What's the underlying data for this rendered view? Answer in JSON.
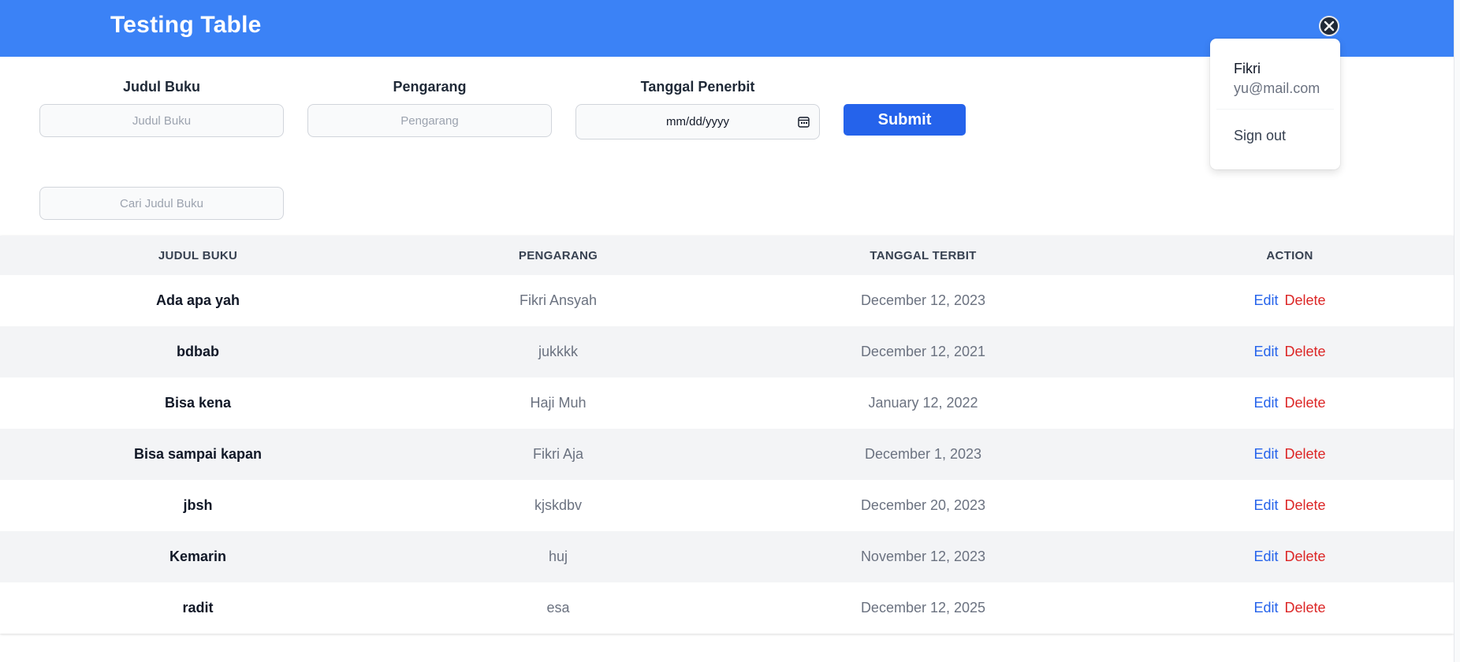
{
  "header": {
    "title": "Testing Table",
    "avatar_icon": "close-circle-icon",
    "bg_color": "#3b82f6"
  },
  "form": {
    "title_label": "Judul Buku",
    "title_placeholder": "Judul Buku",
    "author_label": "Pengarang",
    "author_placeholder": "Pengarang",
    "date_label": "Tanggal Penerbit",
    "date_placeholder": "mm/dd/yyyy",
    "submit_label": "Submit"
  },
  "search": {
    "placeholder": "Cari Judul Buku"
  },
  "table": {
    "headers": [
      "JUDUL BUKU",
      "PENGARANG",
      "TANGGAL TERBIT",
      "ACTION"
    ],
    "rows": [
      {
        "title": "Ada apa yah",
        "author": "Fikri Ansyah",
        "date": "December 12, 2023"
      },
      {
        "title": "bdbab",
        "author": "jukkkk",
        "date": "December 12, 2021"
      },
      {
        "title": "Bisa kena",
        "author": "Haji Muh",
        "date": "January 12, 2022"
      },
      {
        "title": "Bisa sampai kapan",
        "author": "Fikri Aja",
        "date": "December 1, 2023"
      },
      {
        "title": "jbsh",
        "author": "kjskdbv",
        "date": "December 20, 2023"
      },
      {
        "title": "Kemarin",
        "author": "huj",
        "date": "November 12, 2023"
      },
      {
        "title": "radit",
        "author": "esa",
        "date": "December 12, 2025"
      }
    ],
    "edit_label": "Edit",
    "delete_label": "Delete"
  },
  "user_menu": {
    "name": "Fikri",
    "email": "yu@mail.com",
    "sign_out_label": "Sign out"
  }
}
